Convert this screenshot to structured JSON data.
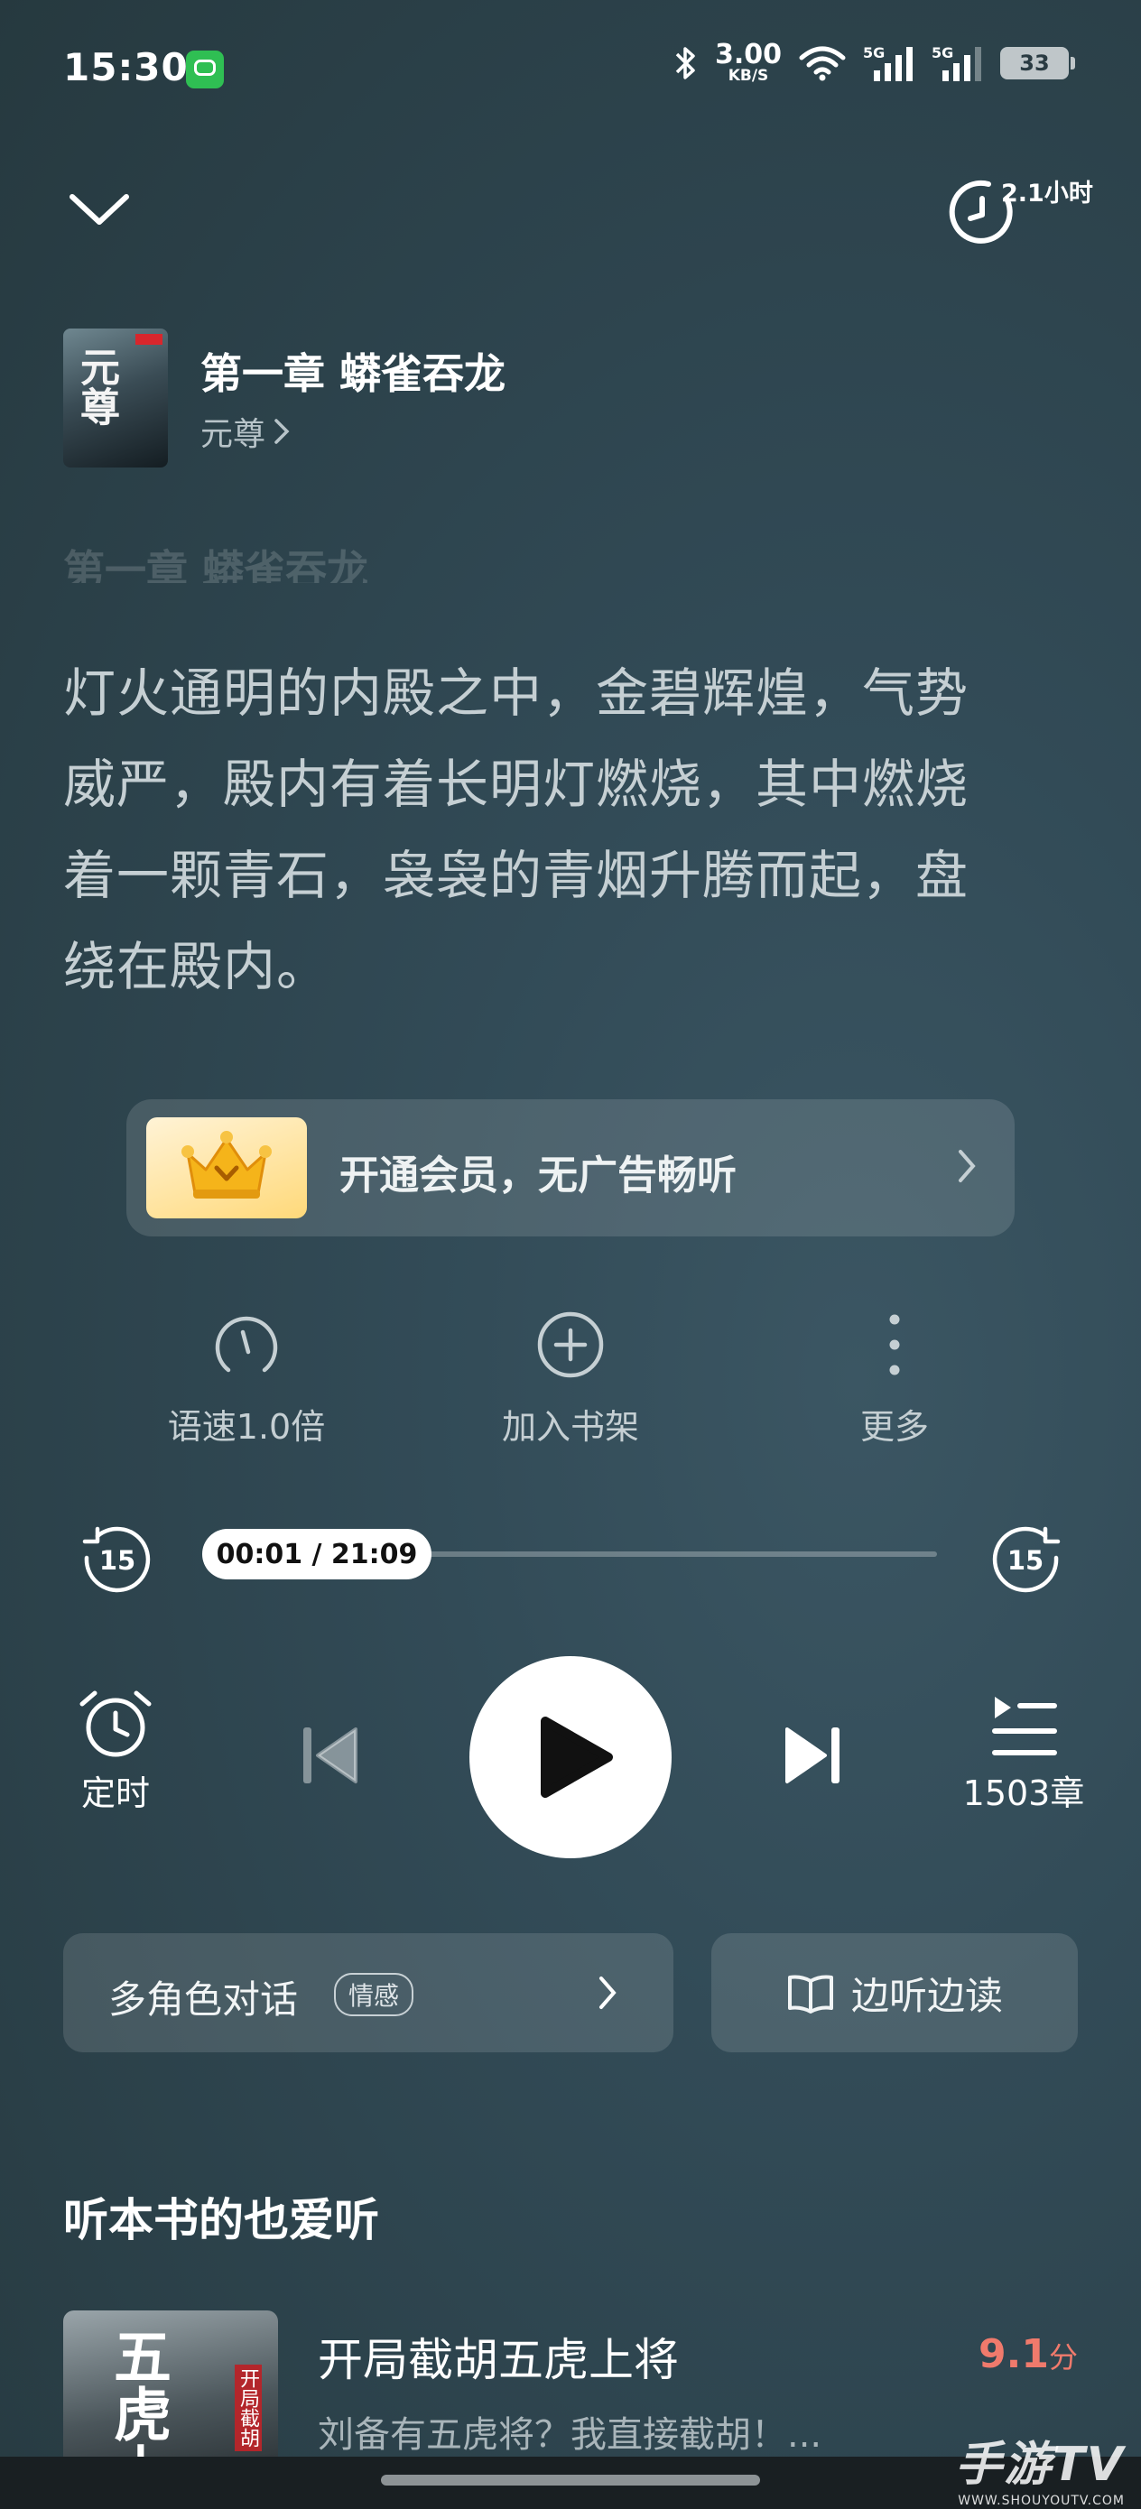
{
  "status_bar": {
    "time": "15:30",
    "net_speed_value": "3.00",
    "net_speed_unit": "KB/S",
    "battery": "33",
    "icons": [
      "message-icon",
      "bluetooth-icon",
      "wifi-icon",
      "signal-5g-icon",
      "signal-5g-icon"
    ]
  },
  "header": {
    "sleep_timer_label": "2.1小时"
  },
  "book": {
    "cover_text": "元尊",
    "chapter_title": "第一章 蟒雀吞龙",
    "author_link": "元尊"
  },
  "content": {
    "faded_title": "第一章 蟒雀吞龙",
    "lines": [
      "灯火通明的内殿之中，金碧辉煌，气势",
      "威严，殿内有着长明灯燃烧，其中燃烧",
      "着一颗青石，袅袅的青烟升腾而起，盘",
      "绕在殿内。"
    ]
  },
  "vip_banner": {
    "text": "开通会员，无广告畅听",
    "icon": "crown-icon"
  },
  "actions": {
    "speed": "语速1.0倍",
    "add_shelf": "加入书架",
    "more": "更多"
  },
  "progress": {
    "current": "00:01",
    "total": "21:09",
    "display": "00:01 / 21:09",
    "fraction": 0.0008,
    "rewind_seconds": "15",
    "forward_seconds": "15"
  },
  "controls": {
    "timer_label": "定时",
    "chapters_label": "1503章"
  },
  "features": {
    "multi_role": "多角色对话",
    "multi_role_tag": "情感",
    "listen_read": "边听边读"
  },
  "recommendations": {
    "heading": "听本书的也爱听",
    "items": [
      {
        "cover_text": "五虎上",
        "cover_tag": "开局截胡",
        "title": "开局截胡五虎上将",
        "desc": "刘备有五虎将？我直接截胡！...",
        "score": "9.1",
        "score_unit": "分"
      }
    ]
  },
  "watermark": {
    "main": "手游TV",
    "sub": "WWW.SHOUYOUTV.COM"
  }
}
